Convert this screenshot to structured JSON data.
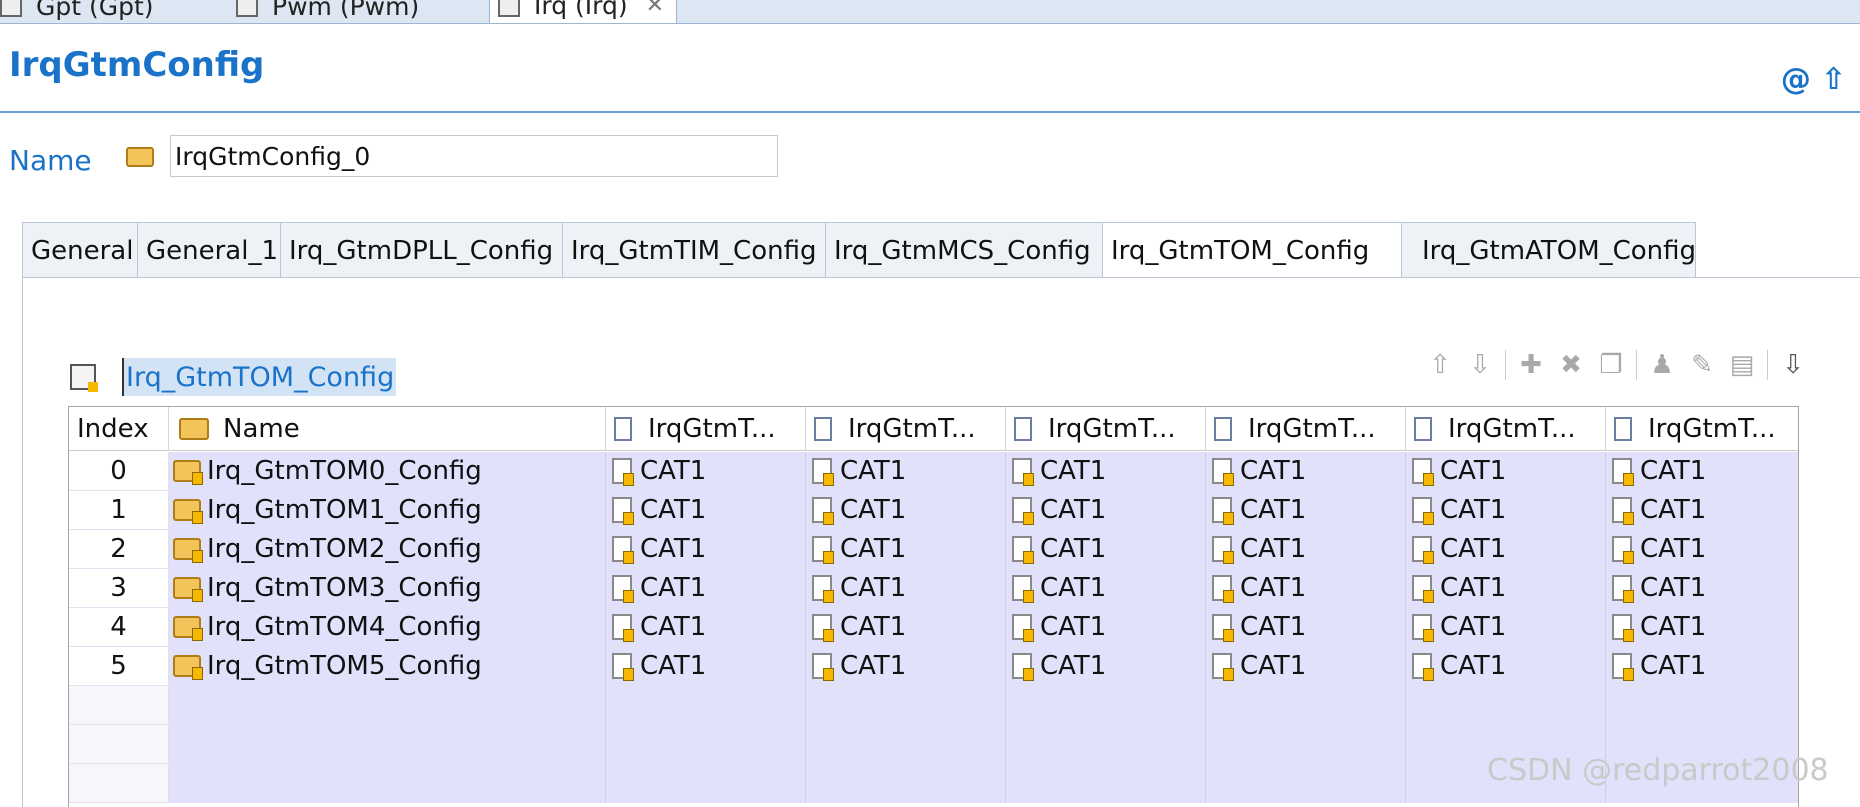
{
  "editor_tabs": [
    {
      "label": "Gpt (Gpt)"
    },
    {
      "label": "Pwm (Pwm)"
    },
    {
      "label": "Irq (Irq)",
      "active": true
    }
  ],
  "page": {
    "title": "IrqGtmConfig"
  },
  "name_field": {
    "label": "Name",
    "value": "IrqGtmConfig_0"
  },
  "section_tabs": [
    {
      "label": "General"
    },
    {
      "label": "General_1"
    },
    {
      "label": "Irq_GtmDPLL_Config"
    },
    {
      "label": "Irq_GtmTIM_Config"
    },
    {
      "label": "Irq_GtmMCS_Config"
    },
    {
      "label": "Irq_GtmTOM_Config",
      "active": true
    },
    {
      "label": "Irq_GtmATOM_Config"
    }
  ],
  "table": {
    "title": "Irq_GtmTOM_Config",
    "columns": [
      "Index",
      "Name",
      "IrqGtmT...",
      "IrqGtmT...",
      "IrqGtmT...",
      "IrqGtmT...",
      "IrqGtmT...",
      "IrqGtmT..."
    ],
    "rows": [
      {
        "index": "0",
        "name": "Irq_GtmTOM0_Config",
        "values": [
          "CAT1",
          "CAT1",
          "CAT1",
          "CAT1",
          "CAT1",
          "CAT1"
        ]
      },
      {
        "index": "1",
        "name": "Irq_GtmTOM1_Config",
        "values": [
          "CAT1",
          "CAT1",
          "CAT1",
          "CAT1",
          "CAT1",
          "CAT1"
        ]
      },
      {
        "index": "2",
        "name": "Irq_GtmTOM2_Config",
        "values": [
          "CAT1",
          "CAT1",
          "CAT1",
          "CAT1",
          "CAT1",
          "CAT1"
        ]
      },
      {
        "index": "3",
        "name": "Irq_GtmTOM3_Config",
        "values": [
          "CAT1",
          "CAT1",
          "CAT1",
          "CAT1",
          "CAT1",
          "CAT1"
        ]
      },
      {
        "index": "4",
        "name": "Irq_GtmTOM4_Config",
        "values": [
          "CAT1",
          "CAT1",
          "CAT1",
          "CAT1",
          "CAT1",
          "CAT1"
        ]
      },
      {
        "index": "5",
        "name": "Irq_GtmTOM5_Config",
        "values": [
          "CAT1",
          "CAT1",
          "CAT1",
          "CAT1",
          "CAT1",
          "CAT1"
        ]
      }
    ]
  },
  "toolbar": {
    "icons": [
      "move-up-icon",
      "move-down-icon",
      "add-icon",
      "delete-icon",
      "copy-icon",
      "user-settings-icon",
      "edit-icon",
      "table-edit-icon",
      "import-icon"
    ]
  },
  "watermark": "CSDN @redparrot2008",
  "colors": {
    "accent": "#1a73c8",
    "row_highlight": "#e1e1fb",
    "tab_border": "#b9c6d6"
  }
}
